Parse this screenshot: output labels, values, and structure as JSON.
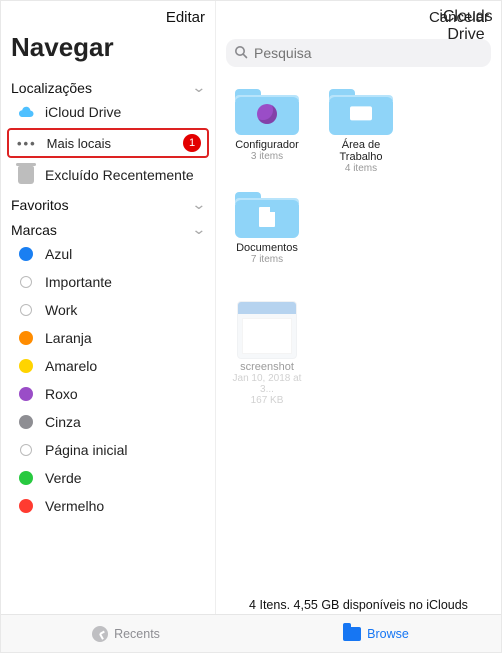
{
  "sidebar": {
    "edit": "Editar",
    "title": "Navegar",
    "sections": {
      "locations": {
        "header": "Localizações",
        "icloud": "iCloud Drive",
        "more": "Mais locais",
        "more_badge": "1",
        "deleted": "Excluído Recentemente"
      },
      "favorites": {
        "header": "Favoritos"
      },
      "tags": {
        "header": "Marcas",
        "items": [
          {
            "label": "Azul",
            "color": "#1a7ff2"
          },
          {
            "label": "Importante",
            "color": ""
          },
          {
            "label": "Work",
            "color": ""
          },
          {
            "label": "Laranja",
            "color": "#ff8c00"
          },
          {
            "label": "Amarelo",
            "color": "#ffd400"
          },
          {
            "label": "Roxo",
            "color": "#9a4dc7"
          },
          {
            "label": "Cinza",
            "color": "#8e8e93"
          },
          {
            "label": "Página inicial",
            "color": ""
          },
          {
            "label": "Verde",
            "color": "#28c940"
          },
          {
            "label": "Vermelho",
            "color": "#ff3b30"
          }
        ]
      }
    }
  },
  "content": {
    "title": "iClouds Drive",
    "cancel": "Cancelar",
    "searchPlaceholder": "Pesquisa",
    "items": [
      {
        "name": "Configurador",
        "sub": "3 items",
        "kind": "config"
      },
      {
        "name": "Área de Trabalho",
        "sub": "4 items",
        "kind": "desktop"
      },
      {
        "name": "Documentos",
        "sub": "7 items",
        "kind": "docs"
      }
    ],
    "faded": {
      "name": "screenshot",
      "sub1": "Jan 10, 2018 at 3...",
      "sub2": "167 KB"
    },
    "status": "4 Itens. 4,55 GB disponíveis no iClouds"
  },
  "tabs": {
    "recents": "Recents",
    "browse": "Browse"
  }
}
